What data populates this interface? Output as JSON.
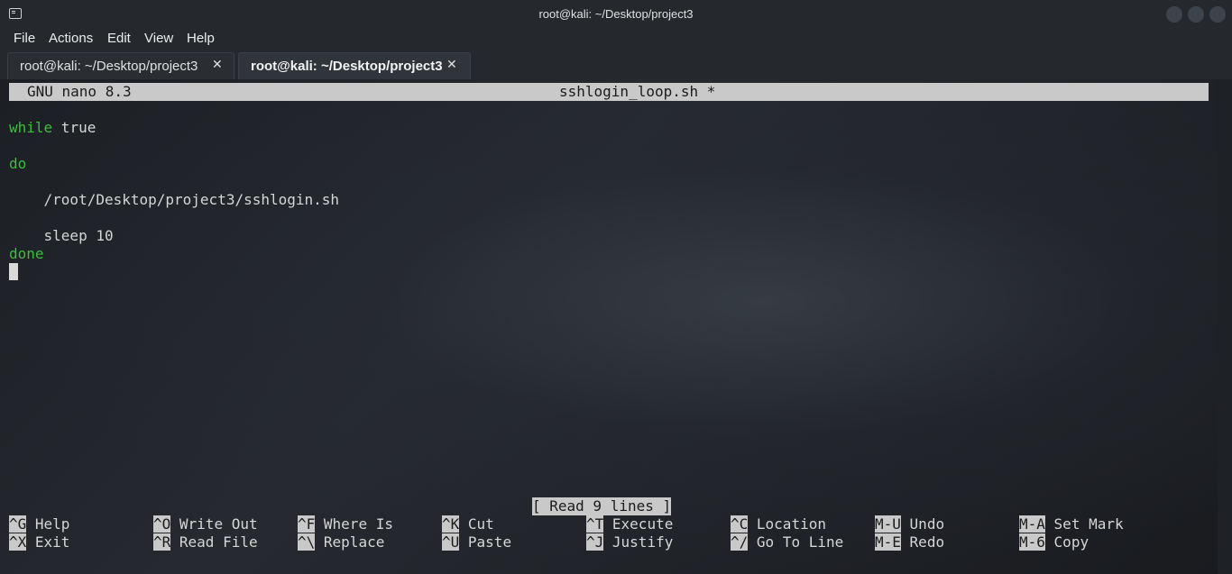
{
  "window": {
    "title": "root@kali: ~/Desktop/project3"
  },
  "menu": [
    "File",
    "Actions",
    "Edit",
    "View",
    "Help"
  ],
  "tabs": [
    {
      "label": "root@kali: ~/Desktop/project3",
      "active": false
    },
    {
      "label": "root@kali: ~/Desktop/project3",
      "active": true
    }
  ],
  "tab_close_glyph": "✕",
  "nano": {
    "version": "GNU nano 8.3",
    "filename": "sshlogin_loop.sh *",
    "lines": [
      {
        "keyword": "while",
        "rest": " true"
      },
      {
        "keyword": "",
        "rest": ""
      },
      {
        "keyword": "do",
        "rest": ""
      },
      {
        "keyword": "",
        "rest": ""
      },
      {
        "keyword": "",
        "rest": "    /root/Desktop/project3/sshlogin.sh"
      },
      {
        "keyword": "",
        "rest": ""
      },
      {
        "keyword": "",
        "rest": "    sleep 10"
      },
      {
        "keyword": "done",
        "rest": ""
      }
    ],
    "status": "[ Read 9 lines ]",
    "shortcuts": [
      {
        "key": "^G",
        "label": "Help"
      },
      {
        "key": "^X",
        "label": "Exit"
      },
      {
        "key": "^O",
        "label": "Write Out"
      },
      {
        "key": "^R",
        "label": "Read File"
      },
      {
        "key": "^F",
        "label": "Where Is"
      },
      {
        "key": "^\\",
        "label": "Replace"
      },
      {
        "key": "^K",
        "label": "Cut"
      },
      {
        "key": "^U",
        "label": "Paste"
      },
      {
        "key": "^T",
        "label": "Execute"
      },
      {
        "key": "^J",
        "label": "Justify"
      },
      {
        "key": "^C",
        "label": "Location"
      },
      {
        "key": "^/",
        "label": "Go To Line"
      },
      {
        "key": "M-U",
        "label": "Undo"
      },
      {
        "key": "M-E",
        "label": "Redo"
      },
      {
        "key": "M-A",
        "label": "Set Mark"
      },
      {
        "key": "M-6",
        "label": "Copy"
      }
    ]
  },
  "colors": {
    "keyword": "#3bbf3b",
    "header_bg": "#c9c9c9"
  }
}
